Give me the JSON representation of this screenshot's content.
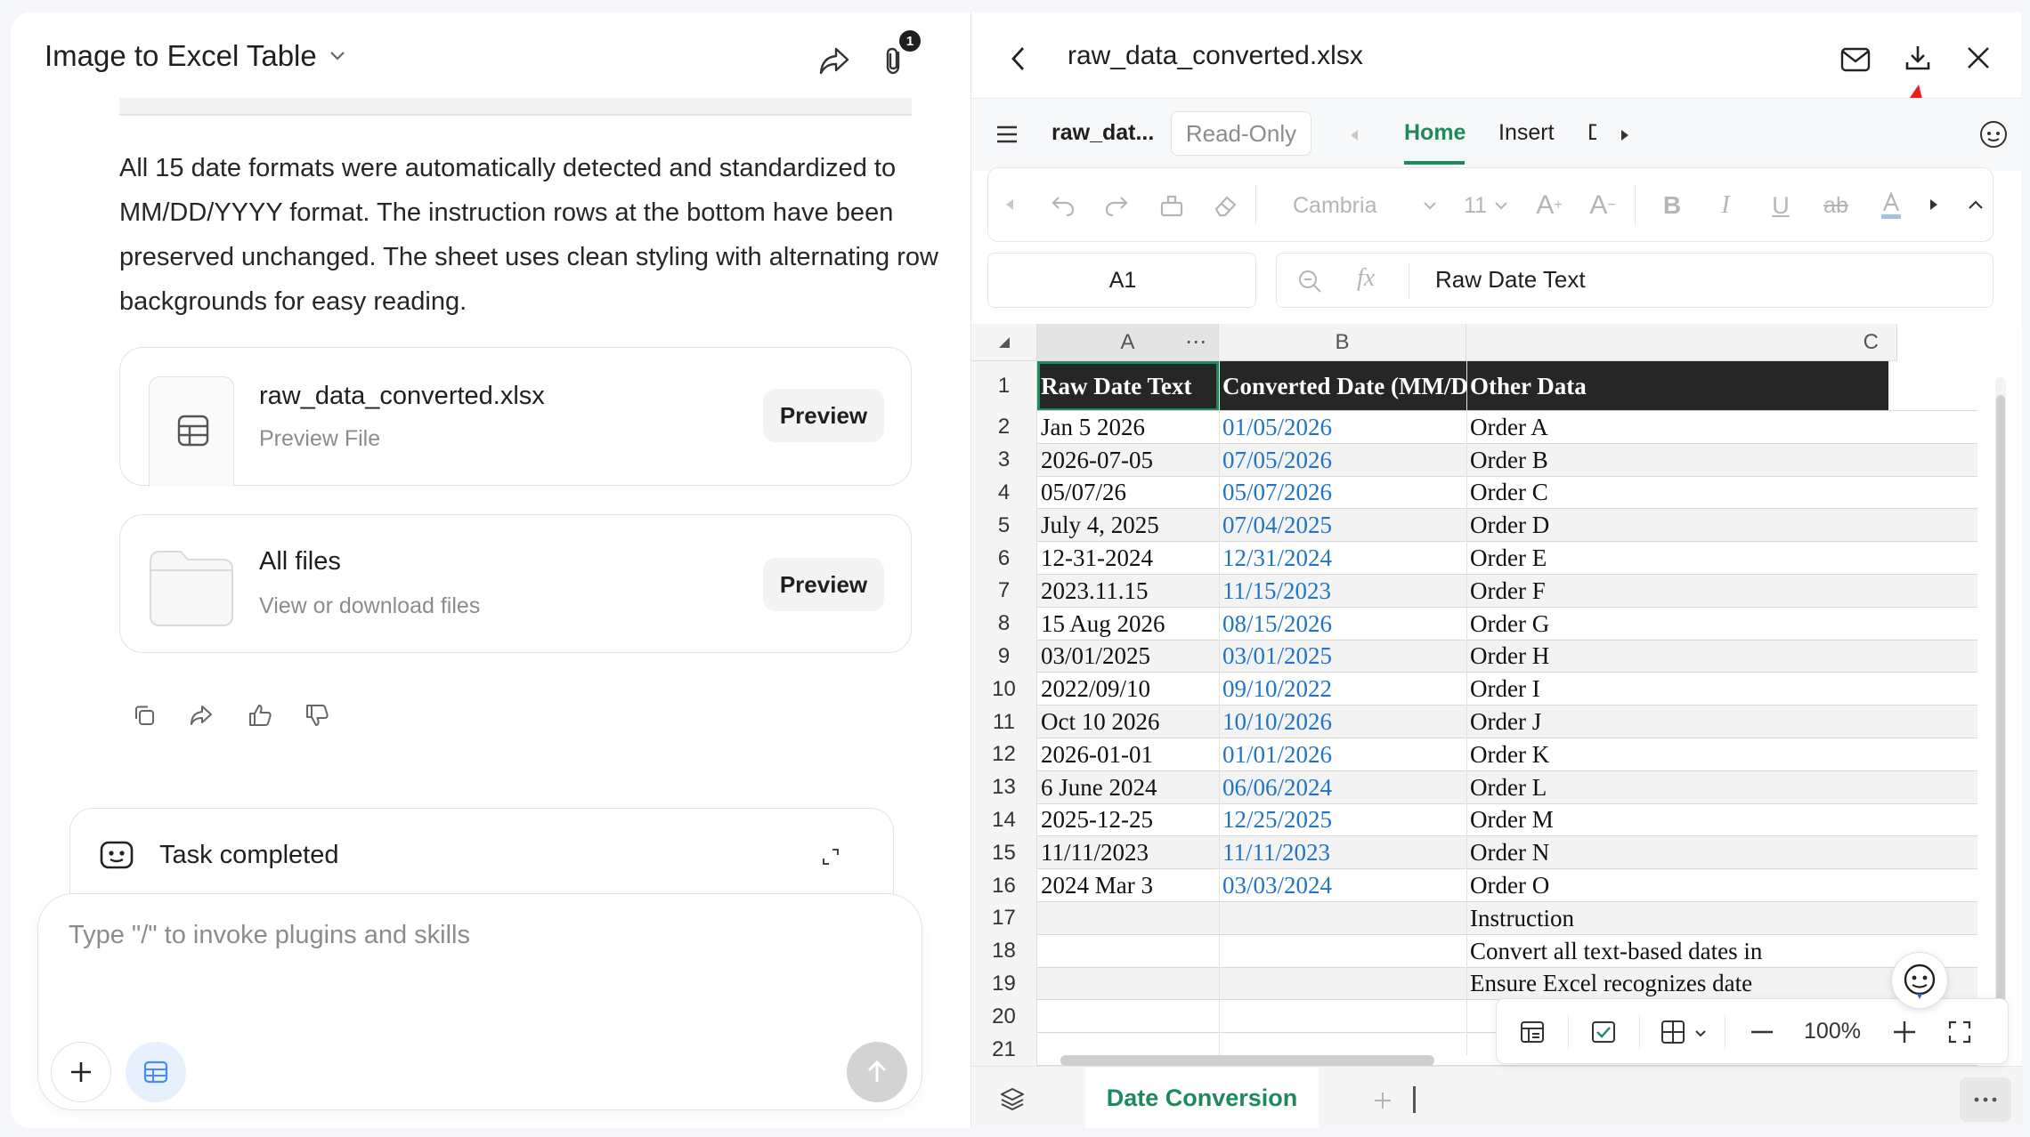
{
  "chat": {
    "title": "Image to Excel Table",
    "attachment_count": "1",
    "message": "All 15 date formats were automatically detected and standardized to MM/DD/YYYY format. The instruction rows at the bottom have been preserved unchanged. The sheet uses clean styling with alternating row backgrounds for easy reading.",
    "file_card": {
      "name": "raw_data_converted.xlsx",
      "sub": "Preview File",
      "button": "Preview"
    },
    "all_files_card": {
      "name": "All files",
      "sub": "View or download files",
      "button": "Preview"
    },
    "task_status": "Task completed",
    "input_placeholder": "Type \"/\" to invoke plugins and skills"
  },
  "viewer": {
    "file_title": "raw_data_converted.xlsx",
    "doc_name": "raw_dat...",
    "mode_badge": "Read-Only",
    "tabs": [
      "Home",
      "Insert",
      "D"
    ],
    "active_tab": "Home",
    "font_name": "Cambria",
    "font_size": "11",
    "cell_ref": "A1",
    "formula_value": "Raw Date Text",
    "fx_label": "fx",
    "zoom": "100%",
    "sheet_tab": "Date Conversion",
    "accent_color": "#1e8a5c",
    "link_color": "#1f74c9"
  },
  "sheet": {
    "columns": [
      "A",
      "B",
      "C"
    ],
    "header": [
      "Raw Date Text",
      "Converted Date (MM/DD/YYYY)",
      "Other Data"
    ],
    "row_numbers": [
      "1",
      "2",
      "3",
      "4",
      "5",
      "6",
      "7",
      "8",
      "9",
      "10",
      "11",
      "12",
      "13",
      "14",
      "15",
      "16",
      "17",
      "18",
      "19",
      "20",
      "21"
    ],
    "rows": [
      [
        "Jan 5 2026",
        "01/05/2026",
        "Order A"
      ],
      [
        "2026-07-05",
        "07/05/2026",
        "Order B"
      ],
      [
        "05/07/26",
        "05/07/2026",
        "Order C"
      ],
      [
        "July 4, 2025",
        "07/04/2025",
        "Order D"
      ],
      [
        "12-31-2024",
        "12/31/2024",
        "Order E"
      ],
      [
        "2023.11.15",
        "11/15/2023",
        "Order F"
      ],
      [
        "15 Aug 2026",
        "08/15/2026",
        "Order G"
      ],
      [
        "03/01/2025",
        "03/01/2025",
        "Order H"
      ],
      [
        "2022/09/10",
        "09/10/2022",
        "Order I"
      ],
      [
        "Oct 10 2026",
        "10/10/2026",
        "Order J"
      ],
      [
        "2026-01-01",
        "01/01/2026",
        "Order K"
      ],
      [
        "6 June 2024",
        "06/06/2024",
        "Order L"
      ],
      [
        "2025-12-25",
        "12/25/2025",
        "Order M"
      ],
      [
        "11/11/2023",
        "11/11/2023",
        "Order N"
      ],
      [
        "2024 Mar 3",
        "03/03/2024",
        "Order O"
      ],
      [
        "",
        "",
        "Instruction"
      ],
      [
        "",
        "",
        "Convert all text-based dates in"
      ],
      [
        "",
        "",
        "Ensure Excel recognizes date"
      ]
    ]
  }
}
